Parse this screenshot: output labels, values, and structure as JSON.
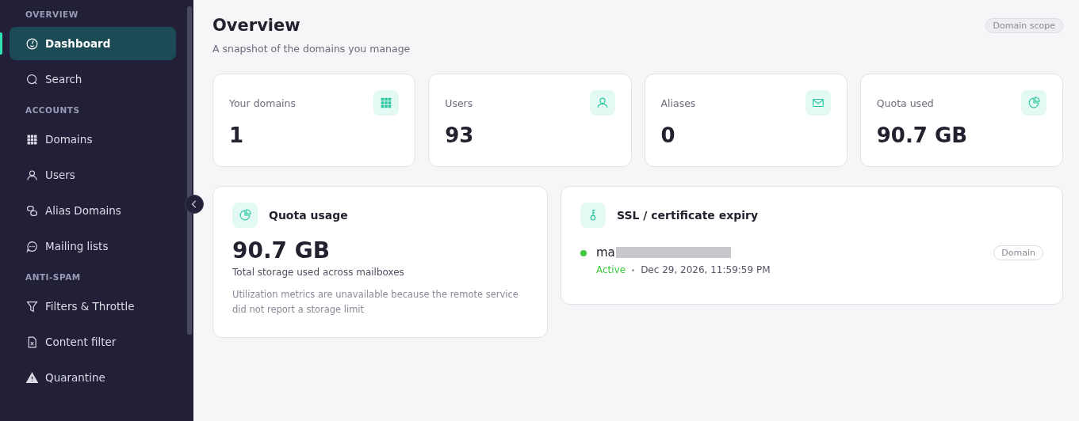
{
  "sidebar": {
    "sections": [
      {
        "heading": "OVERVIEW",
        "items": [
          {
            "label": "Dashboard",
            "selected": true
          },
          {
            "label": "Search",
            "selected": false
          }
        ]
      },
      {
        "heading": "ACCOUNTS",
        "items": [
          {
            "label": "Domains",
            "selected": false
          },
          {
            "label": "Users",
            "selected": false
          },
          {
            "label": "Alias Domains",
            "selected": false
          },
          {
            "label": "Mailing lists",
            "selected": false
          }
        ]
      },
      {
        "heading": "ANTI-SPAM",
        "items": [
          {
            "label": "Filters & Throttle",
            "selected": false
          },
          {
            "label": "Content filter",
            "selected": false
          },
          {
            "label": "Quarantine",
            "selected": false
          }
        ]
      }
    ]
  },
  "header": {
    "title": "Overview",
    "subtitle": "A snapshot of the domains you manage",
    "scope_badge": "Domain scope"
  },
  "stats": [
    {
      "label": "Your domains",
      "value": "1"
    },
    {
      "label": "Users",
      "value": "93"
    },
    {
      "label": "Aliases",
      "value": "0"
    },
    {
      "label": "Quota used",
      "value": "90.7 GB"
    }
  ],
  "quota_card": {
    "title": "Quota usage",
    "value": "90.7 GB",
    "caption": "Total storage used across mailboxes",
    "note": "Utilization metrics are unavailable because the remote service did not report a storage limit"
  },
  "ssl_card": {
    "title": "SSL / certificate expiry",
    "entries": [
      {
        "name": "ma",
        "status": "Active",
        "color": "#3ec93e",
        "expires": "Dec 29, 2026, 11:59:59 PM",
        "tag": "Domain"
      }
    ]
  }
}
